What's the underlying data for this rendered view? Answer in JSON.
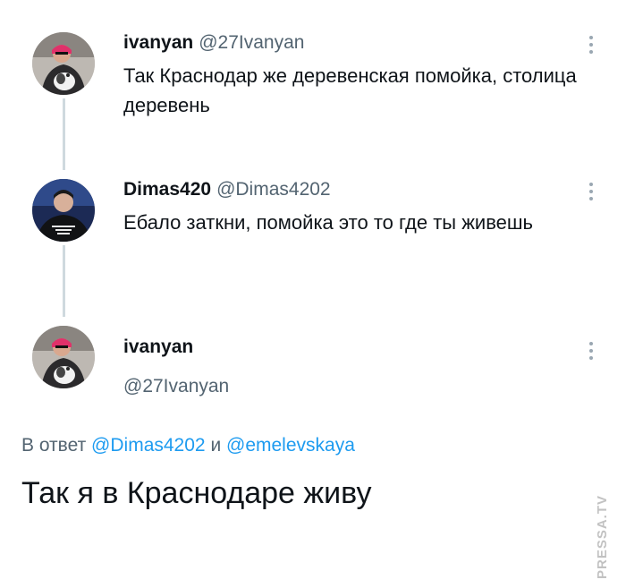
{
  "tweets": [
    {
      "display_name": "ivanyan",
      "handle": "@27Ivanyan",
      "text": "Так Краснодар же деревенская помойка, столица деревень",
      "avatar_icon": "avatar-photo-person-with-dog"
    },
    {
      "display_name": "Dimas420",
      "handle": "@Dimas4202",
      "text": "Ебало заткни, помойка это то где ты живешь",
      "avatar_icon": "avatar-photo-person-in-sweatshirt"
    }
  ],
  "main_tweet": {
    "display_name": "ivanyan",
    "handle": "@27Ivanyan",
    "reply_prefix": "В ответ",
    "reply_mention_1": "@Dimas4202",
    "reply_joiner": "и",
    "reply_mention_2": "@emelevskaya",
    "text": "Так я в Краснодаре живу",
    "avatar_icon": "avatar-photo-person-with-dog"
  },
  "watermark": "PRESSA.TV",
  "colors": {
    "text": "#0f1419",
    "secondary": "#536471",
    "link": "#1d9bf0",
    "thread_line": "#cfd9de"
  }
}
